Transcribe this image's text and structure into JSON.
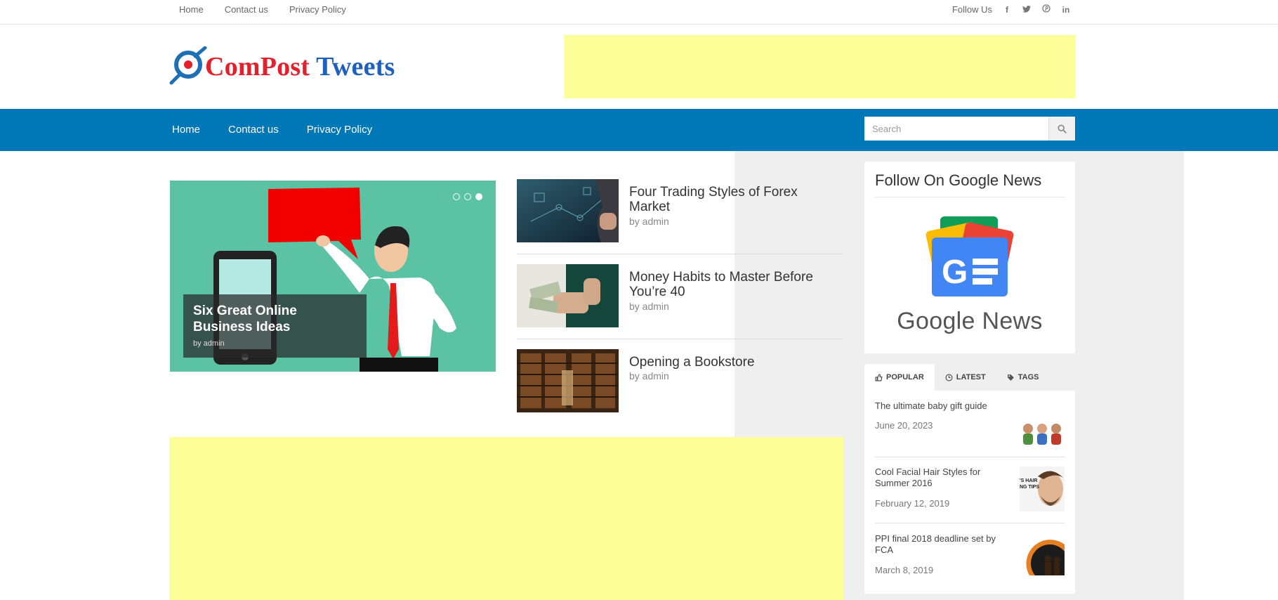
{
  "topbar": {
    "nav": [
      "Home",
      "Contact us",
      "Privacy Policy"
    ],
    "follow_label": "Follow Us",
    "social_icons": [
      "facebook-icon",
      "twitter-icon",
      "pinterest-icon",
      "linkedin-icon"
    ]
  },
  "logo": {
    "part1": "ComPost",
    "part2": "Tweets"
  },
  "mainnav": {
    "links": [
      "Home",
      "Contact us",
      "Privacy Policy"
    ],
    "search_placeholder": "Search"
  },
  "slider": {
    "title": "Six Great Online Business Ideas",
    "author": "by admin",
    "dot_count": 3,
    "active_dot": 3
  },
  "posts": [
    {
      "title": "Four Trading Styles of Forex Market",
      "author": "by admin"
    },
    {
      "title": "Money Habits to Master Before You’re 40",
      "author": "by admin"
    },
    {
      "title": "Opening a Bookstore",
      "author": "by admin"
    }
  ],
  "sidebar": {
    "news_widget_title": "Follow On Google News",
    "news_logo_text": "Google News",
    "tabs": [
      "POPULAR",
      "LATEST",
      "TAGS"
    ],
    "active_tab": "POPULAR",
    "popular": [
      {
        "title": "The ultimate baby gift guide",
        "date": "June 20, 2023"
      },
      {
        "title": "Cool Facial Hair Styles for Summer 2016",
        "date": "February 12, 2019"
      },
      {
        "title": "PPI final 2018 deadline set by FCA",
        "date": "March 8, 2019"
      }
    ]
  },
  "colors": {
    "nav_blue": "#0077b6",
    "ad_yellow": "#ffff99",
    "slider_green": "#5cc2a4",
    "logo_red": "#e4202c",
    "logo_blue": "#1f5fbf"
  }
}
